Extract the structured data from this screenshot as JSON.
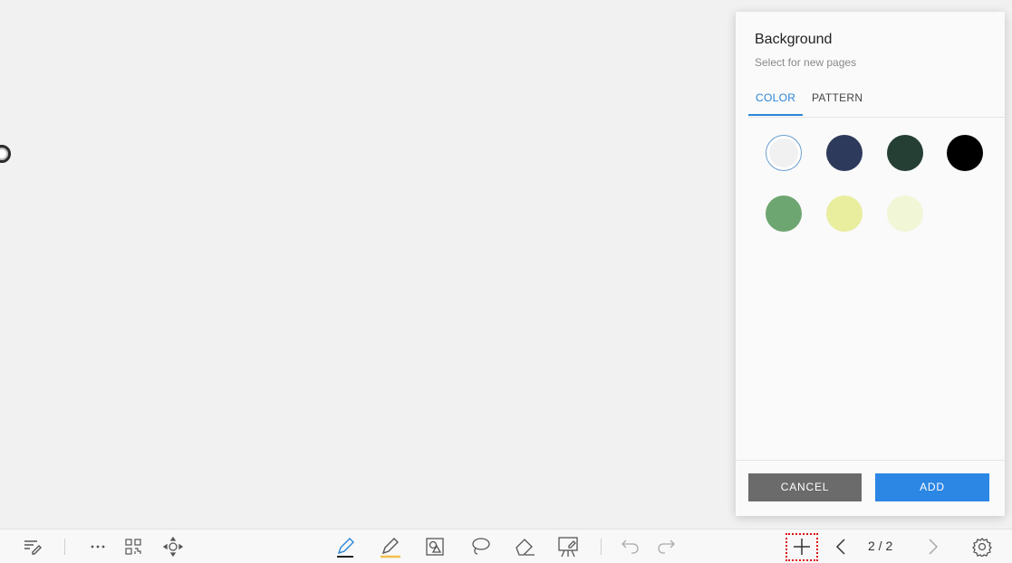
{
  "panel": {
    "title": "Background",
    "subtitle": "Select for new pages",
    "tabs": [
      {
        "label": "COLOR",
        "active": true
      },
      {
        "label": "PATTERN",
        "active": false
      }
    ],
    "colors": [
      "#f1f1f1",
      "#2e3a5c",
      "#263f35",
      "#000000",
      "#6ea672",
      "#e9ed9e",
      "#f1f6d7"
    ],
    "selected_color_index": 0,
    "cancel_label": "CANCEL",
    "add_label": "ADD",
    "accent": "#2b86e4"
  },
  "toolbar": {
    "page_indicator": "2 / 2",
    "icons": [
      "notes-icon",
      "more-icon",
      "qr-code-icon",
      "move-icon",
      "pen-icon",
      "highlighter-icon",
      "shape-icon",
      "lasso-icon",
      "eraser-icon",
      "presentation-icon",
      "undo-icon",
      "redo-icon",
      "add-page-icon",
      "prev-page-icon",
      "next-page-icon",
      "settings-icon"
    ]
  }
}
